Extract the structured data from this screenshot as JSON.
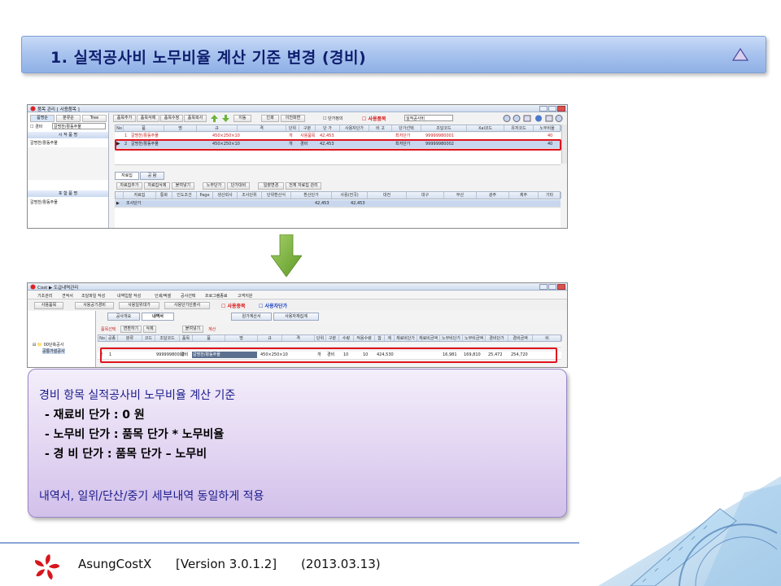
{
  "slide": {
    "title": "1. 실적공사비 노무비율 계산 기준 변경 (경비)"
  },
  "screenshot_top": {
    "window_title": "품목 관리 [ 사용품목 ]",
    "left_tabs": [
      "품명순",
      "분류순",
      "Tree"
    ],
    "left_checkbox": "경비",
    "left_filter": "갈명찬/활동주물",
    "left_section1": "시 작 품 명",
    "left_item1": "갈명찬/활동주물",
    "left_section2": "포 함 품 명",
    "left_item2": "갈명찬/활동주물",
    "toolbar": [
      "품목추가",
      "품목삭제",
      "품목수정",
      "품목복사",
      "이동",
      "인쇄",
      "이전화면",
      "단가정의",
      "사용품목"
    ],
    "toolbar_select": "실적공사비",
    "grid_headers": [
      "No",
      "품",
      "명",
      "규",
      "격",
      "단위",
      "구분",
      "단 가",
      "사용자단가",
      "비 고",
      "단가선택",
      "조달코드",
      "Xal코드",
      "유저코드",
      "노무비율"
    ],
    "rows": [
      {
        "no": "1",
        "name": "갈명찬/활동주물",
        "spec": "450×250×10",
        "unit": "개",
        "type": "사용품목",
        "price": "42,453",
        "choice": "최저단가",
        "code": "99999980001",
        "ratio": "40"
      },
      {
        "no": "2",
        "name": "갈명찬/활동주물",
        "spec": "450×250×10",
        "unit": "개",
        "type": "경비",
        "price": "42,453",
        "choice": "최저단가",
        "code": "99999980002",
        "ratio": "40"
      }
    ],
    "lower_tabs": [
      "자료집",
      "공 람"
    ],
    "lower_toolbar": [
      "자료집추가",
      "자료집삭제",
      "붙여넣기",
      "노무단가",
      "단가대비",
      "일괄변경",
      "전체 자료집 관리"
    ],
    "lower_headers": [
      "자료집",
      "통화",
      "인도조건",
      "Page",
      "생산회사",
      "조사단위",
      "단위환산식",
      "환산단가",
      "사용(전국)",
      "대전",
      "대구",
      "부산",
      "광주",
      "제주",
      "기타"
    ],
    "lower_row": {
      "name": "조사단가",
      "converted": "42,453",
      "used": "42,453"
    }
  },
  "screenshot_bottom": {
    "window_title": "Cost ▶ 도급내역관리",
    "menu": [
      "기초관리",
      "견적서",
      "조달파일 작성",
      "내역입찰 작성",
      "인쇄/엑셀",
      "공사선택",
      "프로그램종료",
      "고객지원"
    ],
    "toolbar": [
      "사용품목",
      "사용공기경비",
      "사용일위대가",
      "사용단가산출서",
      "사용중목",
      "사용자단가"
    ],
    "side_items": [
      "00단축공사",
      "공통가설공사"
    ],
    "sub_tabs": [
      "공사개요",
      "내역서",
      "원가계산서",
      "사용자재집계"
    ],
    "grid_toolbar": [
      "품목선택",
      "변환하기",
      "삭제",
      "붙여넣기",
      "계산"
    ],
    "grid_headers": [
      "No",
      "공종",
      "분류",
      "코드",
      "조달코드",
      "품목",
      "품",
      "명",
      "규",
      "격",
      "단위",
      "구분",
      "수량",
      "적용수량",
      "합",
      "계",
      "재료비단가",
      "재료비금액",
      "노무비단가",
      "노무비금액",
      "경비단가",
      "경비금액",
      "비"
    ],
    "highlight_row": {
      "no": "2",
      "step": "1",
      "code": "99999980002",
      "type": "경비",
      "name": "갈명찬/활동주물",
      "spec": "450×250×10",
      "unit": "개",
      "kind": "경비",
      "qty": "10",
      "apply_qty": "10",
      "total": "424,530",
      "labor_unit": "16,981",
      "labor_amt": "169,810",
      "exp_unit": "25,472",
      "exp_amt": "254,720"
    }
  },
  "callout": {
    "heading": "경비 항목 실적공사비 노무비율 계산 기준",
    "line1": "- 재료비 단가 : 0 원",
    "line2": "- 노무비 단가 : 품목 단가 * 노무비율",
    "line3": "- 경    비 단가 : 품목 단가 – 노무비",
    "footer": "내역서, 일위/단산/중기 세부내역 동일하게 적용"
  },
  "footer": {
    "product": "AsungCostX",
    "version": "[Version 3.0.1.2]",
    "date": "(2013.03.13)"
  },
  "colors": {
    "highlight": "#e0141e",
    "title_text": "#0f1e6e",
    "callout_text": "#1b1b8c",
    "arrow": "#77b135"
  }
}
